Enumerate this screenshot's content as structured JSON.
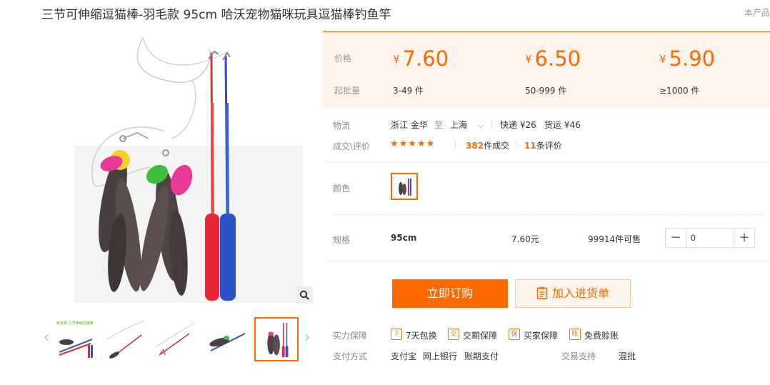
{
  "title": "三节可伸缩逗猫棒-羽毛款 95cm 哈沃宠物猫咪玩具逗猫棒钓鱼竿",
  "corner_note": "本产品",
  "gallery": {
    "thumbnails": [
      "thumb-1",
      "thumb-2",
      "thumb-3",
      "thumb-4",
      "thumb-5"
    ],
    "thumb1_caption": "新毛款 三节伸缩逗猫棒",
    "active_index": 4
  },
  "price": {
    "label_price": "价格",
    "label_moq": "起批量",
    "currency": "¥",
    "tiers": [
      {
        "price": "7.60",
        "moq": "3-49 件"
      },
      {
        "price": "6.50",
        "moq": "50-999 件"
      },
      {
        "price": "5.90",
        "moq": "≥1000 件"
      }
    ]
  },
  "logistics": {
    "label": "物流",
    "from": "浙江 金华",
    "to_word": "至",
    "to": "上海",
    "express": "快递 ¥26",
    "freight": "货运 ¥46"
  },
  "deals": {
    "label": "成交\\评价",
    "stars": "★★★★★",
    "deals_count": "382",
    "deals_suffix": "件成交",
    "reviews_count": "11",
    "reviews_suffix": "条评价"
  },
  "color": {
    "label": "颜色"
  },
  "spec": {
    "label": "规格",
    "name": "95cm",
    "price": "7.60元",
    "stock": "99914件可售",
    "minus": "−",
    "plus": "+",
    "quantity": "0"
  },
  "actions": {
    "order": "立即订购",
    "cart": "加入进货单"
  },
  "guarantee": {
    "label": "实力保障",
    "items": [
      {
        "icon": "7",
        "text": "7天包换"
      },
      {
        "icon": "交",
        "text": "交期保障"
      },
      {
        "icon": "保",
        "text": "买家保障"
      },
      {
        "icon": "账",
        "text": "免费赊账"
      }
    ]
  },
  "payment": {
    "label": "支付方式",
    "methods": [
      "支付宝",
      "网上银行",
      "账期支付"
    ],
    "trade_label": "交易支持",
    "trade_value": "混批"
  },
  "colors": {
    "accent": "#ff6a00",
    "price_bg": "#fff4ec"
  }
}
